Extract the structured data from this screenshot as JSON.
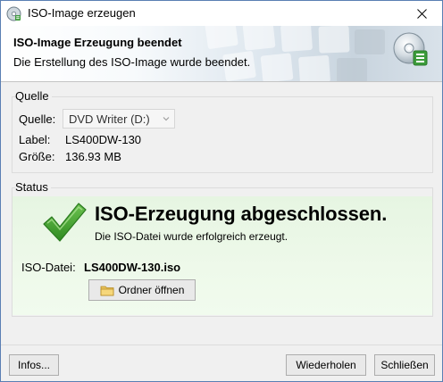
{
  "window": {
    "title": "ISO-Image erzeugen"
  },
  "header": {
    "title": "ISO-Image Erzeugung beendet",
    "subtitle": "Die Erstellung des ISO-Image wurde beendet."
  },
  "source": {
    "group_label": "Quelle",
    "source_label": "Quelle:",
    "source_value": "DVD Writer (D:)",
    "label_label": "Label:",
    "label_value": "LS400DW-130",
    "size_label": "Größe:",
    "size_value": "136.93 MB"
  },
  "status": {
    "group_label": "Status",
    "headline": "ISO-Erzeugung abgeschlossen.",
    "message": "Die ISO-Datei wurde erfolgreich erzeugt.",
    "iso_label": "ISO-Datei:",
    "iso_value": "LS400DW-130.iso",
    "open_folder_label": "Ordner öffnen"
  },
  "footer": {
    "infos_label": "Infos...",
    "retry_label": "Wiederholen",
    "close_label": "Schließen"
  },
  "colors": {
    "status_background": "#eaf7e6",
    "check_green": "#3d9a2a",
    "window_border": "#5a7fb3"
  },
  "icons": {
    "app": "disc-app-icon",
    "close": "close-icon",
    "header": "disc-icon",
    "status": "checkmark-icon",
    "folder": "folder-icon",
    "combo": "chevron-down-icon"
  }
}
